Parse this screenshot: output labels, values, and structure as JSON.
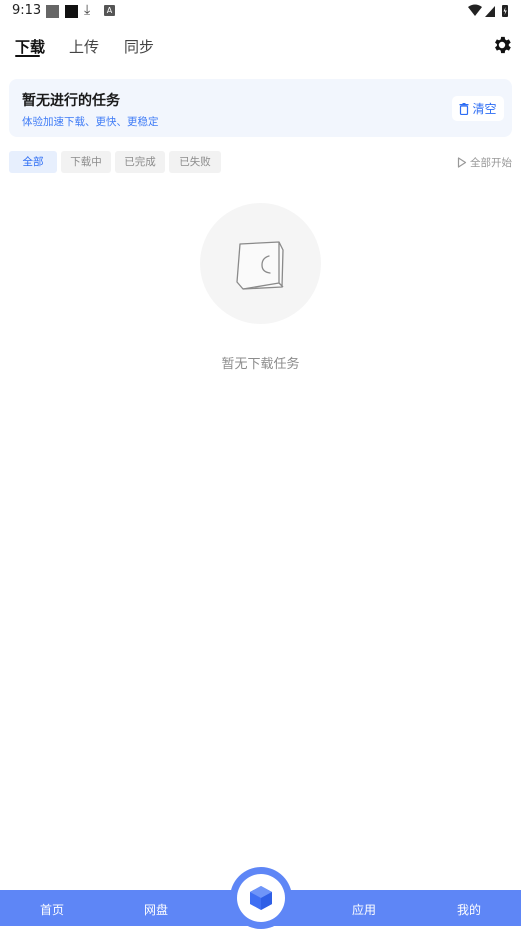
{
  "status_bar": {
    "time": "9:13",
    "a_badge": "A"
  },
  "tabs": [
    {
      "label": "下载",
      "active": true
    },
    {
      "label": "上传",
      "active": false
    },
    {
      "label": "同步",
      "active": false
    }
  ],
  "task_card": {
    "title": "暂无进行的任务",
    "subtitle": "体验加速下载、更快、更稳定",
    "clear_label": "清空"
  },
  "filters": [
    {
      "label": "全部",
      "active": true
    },
    {
      "label": "下载中",
      "active": false
    },
    {
      "label": "已完成",
      "active": false
    },
    {
      "label": "已失败",
      "active": false
    }
  ],
  "start_all_label": "全部开始",
  "empty_text": "暂无下载任务",
  "bottom_nav": {
    "items": [
      "首页",
      "网盘",
      "应用",
      "我的"
    ]
  },
  "colors": {
    "accent": "#2d6df4",
    "nav_bg": "#5e86f6"
  }
}
